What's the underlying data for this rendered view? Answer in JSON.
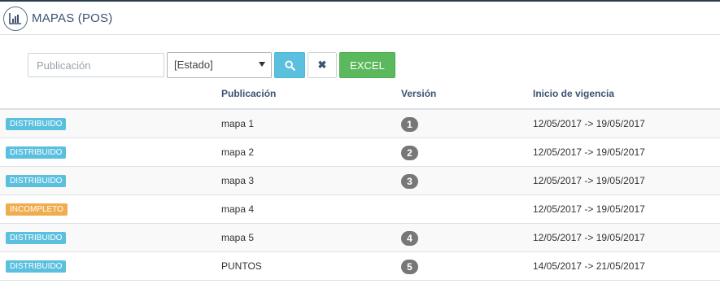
{
  "header": {
    "title": "MAPAS (POS)",
    "icon": "bar-chart-icon"
  },
  "toolbar": {
    "search_placeholder": "Publicación",
    "state_select_value": "[Estado]",
    "search_button_icon": "search-icon",
    "clear_button_label": "✖",
    "excel_label": "EXCEL"
  },
  "table": {
    "columns": [
      "",
      "Publicación",
      "Versión",
      "Inicio de vigencia"
    ],
    "rows": [
      {
        "status": "DISTRIBUIDO",
        "publication": "mapa 1",
        "version": "1",
        "validity": "12/05/2017 -> 19/05/2017"
      },
      {
        "status": "DISTRIBUIDO",
        "publication": "mapa 2",
        "version": "2",
        "validity": "12/05/2017 -> 19/05/2017"
      },
      {
        "status": "DISTRIBUIDO",
        "publication": "mapa 3",
        "version": "3",
        "validity": "12/05/2017 -> 19/05/2017"
      },
      {
        "status": "INCOMPLETO",
        "publication": "mapa 4",
        "version": "",
        "validity": "12/05/2017 -> 19/05/2017"
      },
      {
        "status": "DISTRIBUIDO",
        "publication": "mapa 5",
        "version": "4",
        "validity": "12/05/2017 -> 19/05/2017"
      },
      {
        "status": "DISTRIBUIDO",
        "publication": "PUNTOS",
        "version": "5",
        "validity": "14/05/2017 -> 21/05/2017"
      }
    ]
  },
  "colors": {
    "distribuido": "#5bc0de",
    "incompleto": "#f0ad4e",
    "excel": "#5cb85c",
    "search": "#5bc0de",
    "title": "#3d5270",
    "badge": "#777777"
  }
}
